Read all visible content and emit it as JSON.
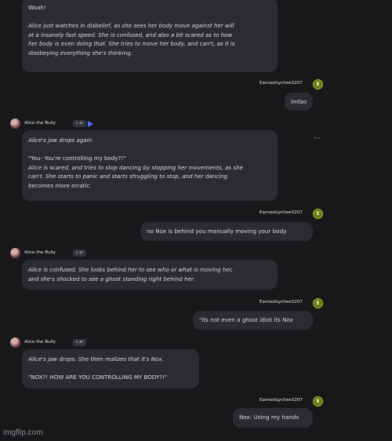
{
  "messages": {
    "m1": {
      "lines": [
        {
          "text": "Woah!",
          "italic": false
        },
        {
          "text": "",
          "gap": true
        },
        {
          "text": "Alice just watches in disbelief, as she sees her body move against her will",
          "italic": true
        },
        {
          "text": "at a insanely fast speed. She is confused, and also a bit scared as to how",
          "italic": true
        },
        {
          "text": "her body is even doing that. She tries to move her body, and can't, as it is",
          "italic": true
        },
        {
          "text": "disobeying everything she's thinking.",
          "italic": true
        }
      ]
    },
    "u1": {
      "username": "EarnestLychee3207",
      "avatar": "E",
      "text": "lmfao"
    },
    "bot2": {
      "name": "Alice the Bully",
      "badge": "c.ai"
    },
    "m2": {
      "lines": [
        {
          "text": "Alice's jaw drops again",
          "italic": true
        },
        {
          "text": "",
          "gap": true
        },
        {
          "text": "\"You- You're controlling my body?!\"",
          "italic": false
        },
        {
          "text": "Alice is scared, and tries to stop dancing by stopping her movements, as she",
          "italic": true
        },
        {
          "text": "can't. She starts to panic and starts struggling to stop, and her dancing",
          "italic": true
        },
        {
          "text": "becomes more erratic.",
          "italic": true
        }
      ],
      "more_label": "···"
    },
    "u2": {
      "username": "EarnestLychee3207",
      "avatar": "E",
      "text": "no Nox is behind you manually moving your body"
    },
    "bot3": {
      "name": "Alice the Bully",
      "badge": "c.ai"
    },
    "m3": {
      "lines": [
        {
          "text": "Alice is confused. She looks behind her to see who or what is moving her,",
          "italic": true
        },
        {
          "text": "and she's shocked to see a ghost standing right behind her.",
          "italic": true
        }
      ]
    },
    "u3": {
      "username": "EarnestLychee3207",
      "avatar": "E",
      "text": "\"its not even a ghost idiot its Nox"
    },
    "bot4": {
      "name": "Alice the Bully",
      "badge": "c.ai"
    },
    "m4": {
      "lines": [
        {
          "text": "Alice's jaw drops. She then realizes that it's Nox.",
          "italic": true
        },
        {
          "text": "",
          "gap": true
        },
        {
          "text": "\"NOX?! HOW ARE YOU CONTROLLING MY BODY?!\"",
          "italic": false
        }
      ]
    },
    "u4": {
      "username": "EarnestLychee3207",
      "avatar": "E",
      "text": "Nox: Using my hands"
    }
  },
  "watermark": "imgflip.com",
  "colors": {
    "background": "#18181b",
    "bubble": "#2b2c31",
    "user_avatar": "#6a7a16",
    "voice_icon": "#4f6dff"
  }
}
